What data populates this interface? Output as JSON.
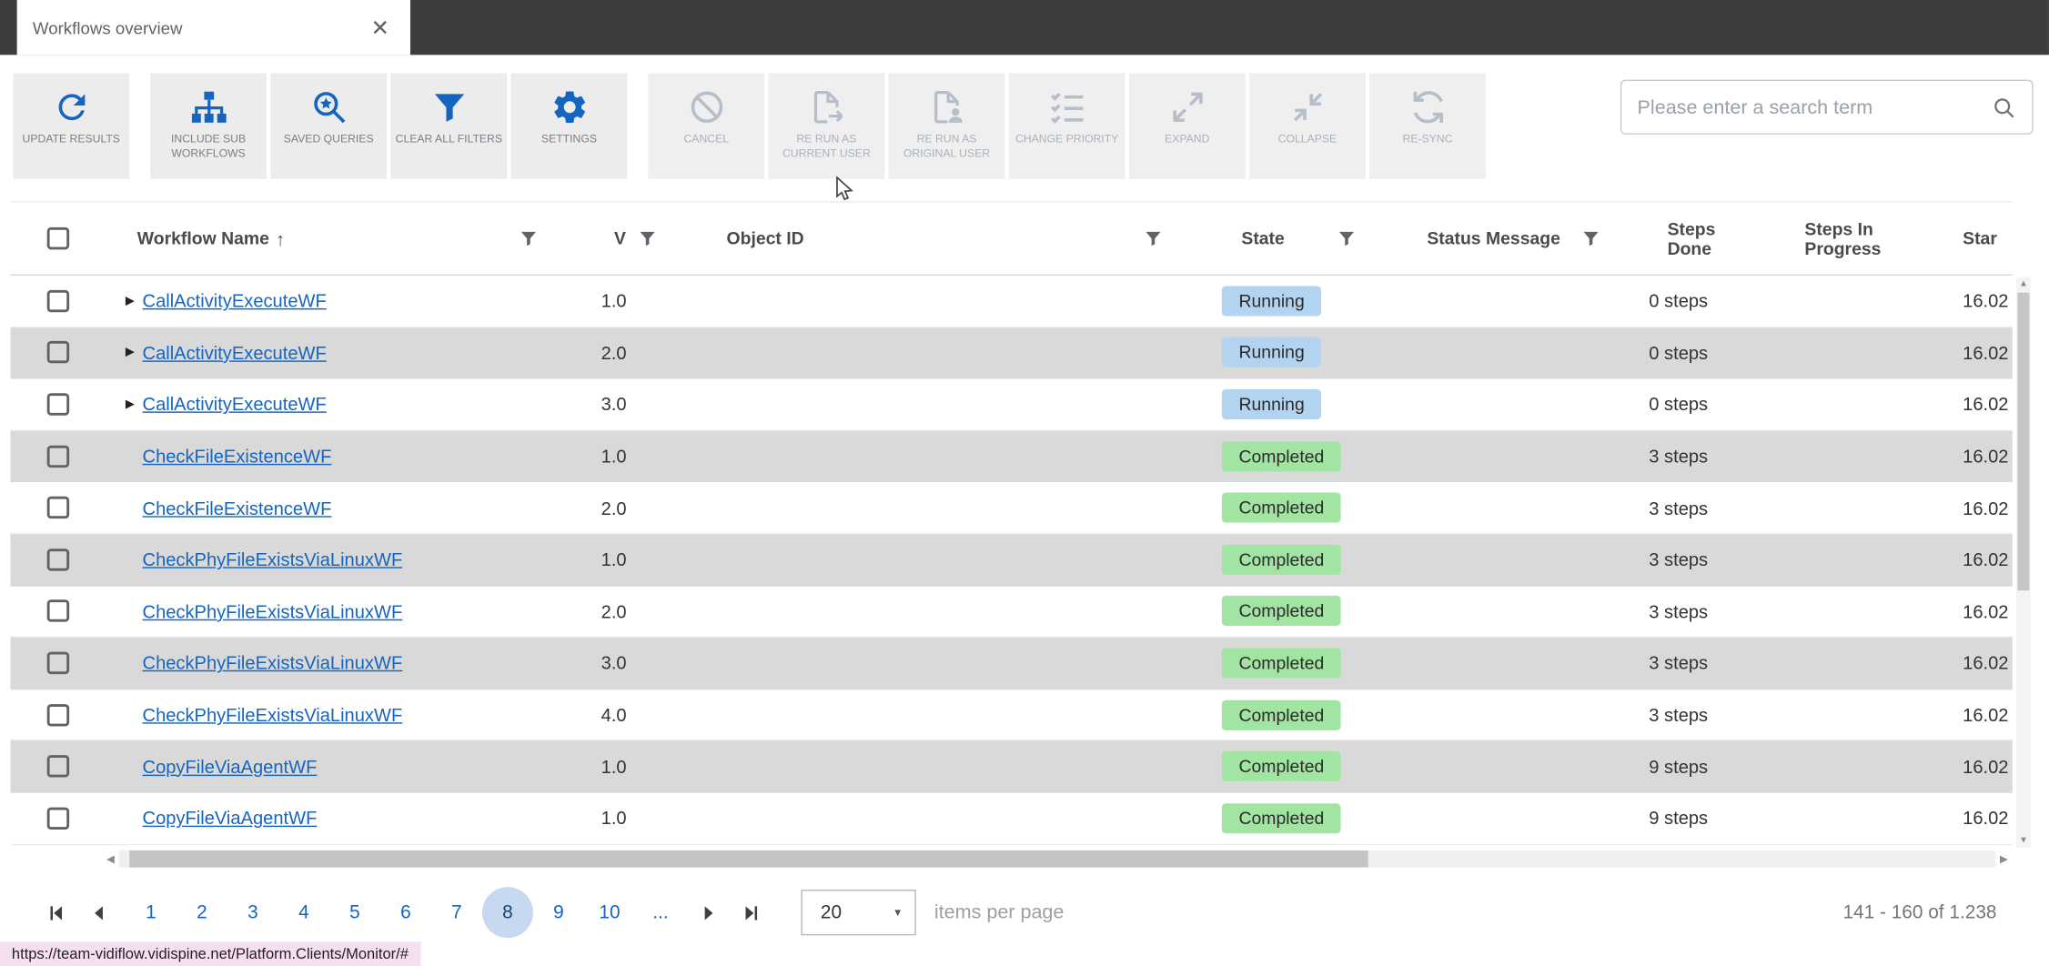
{
  "tab": {
    "title": "Workflows overview"
  },
  "toolbar": {
    "buttons": [
      {
        "label": "UPDATE RESULTS",
        "icon": "refresh-icon",
        "enabled": true
      },
      {
        "label": "INCLUDE SUB WORKFLOWS",
        "icon": "hierarchy-icon",
        "enabled": true
      },
      {
        "label": "SAVED QUERIES",
        "icon": "saved-search-icon",
        "enabled": true
      },
      {
        "label": "CLEAR ALL FILTERS",
        "icon": "clear-filters-icon",
        "enabled": true
      },
      {
        "label": "SETTINGS",
        "icon": "gear-icon",
        "enabled": true
      },
      {
        "label": "CANCEL",
        "icon": "cancel-icon",
        "enabled": false
      },
      {
        "label": "RE RUN AS CURRENT USER",
        "icon": "rerun-current-user-icon",
        "enabled": false
      },
      {
        "label": "RE RUN AS ORIGINAL USER",
        "icon": "rerun-original-user-icon",
        "enabled": false
      },
      {
        "label": "CHANGE PRIORITY",
        "icon": "priority-list-icon",
        "enabled": false
      },
      {
        "label": "EXPAND",
        "icon": "expand-icon",
        "enabled": false
      },
      {
        "label": "COLLAPSE",
        "icon": "collapse-icon",
        "enabled": false
      },
      {
        "label": "RE-SYNC",
        "icon": "resync-icon",
        "enabled": false
      }
    ],
    "search": {
      "placeholder": "Please enter a search term"
    }
  },
  "table": {
    "columns": [
      {
        "label": "",
        "key": "select"
      },
      {
        "label": "Workflow Name",
        "key": "name",
        "sorted": "asc",
        "filter": true
      },
      {
        "label": "V",
        "key": "version",
        "filter": true
      },
      {
        "label": "Object ID",
        "key": "object_id",
        "filter": true
      },
      {
        "label": "State",
        "key": "state",
        "filter": true
      },
      {
        "label": "Status Message",
        "key": "status_message",
        "filter": true
      },
      {
        "label": "Steps Done",
        "key": "steps_done",
        "filter": false
      },
      {
        "label": "Steps In Progress",
        "key": "steps_in_progress",
        "filter": false
      },
      {
        "label": "Star",
        "key": "started",
        "filter": false
      }
    ],
    "state_colors": {
      "Running": "#b3d4f0",
      "Completed": "#a2e5a2"
    },
    "rows": [
      {
        "name": "CallActivityExecuteWF",
        "expandable": true,
        "version": "1.0",
        "object_id": "",
        "state": "Running",
        "status_message": "",
        "steps_done": "0 steps",
        "steps_in_progress": "",
        "started": "16.02"
      },
      {
        "name": "CallActivityExecuteWF",
        "expandable": true,
        "version": "2.0",
        "object_id": "",
        "state": "Running",
        "status_message": "",
        "steps_done": "0 steps",
        "steps_in_progress": "",
        "started": "16.02"
      },
      {
        "name": "CallActivityExecuteWF",
        "expandable": true,
        "version": "3.0",
        "object_id": "",
        "state": "Running",
        "status_message": "",
        "steps_done": "0 steps",
        "steps_in_progress": "",
        "started": "16.02"
      },
      {
        "name": "CheckFileExistenceWF",
        "expandable": false,
        "version": "1.0",
        "object_id": "",
        "state": "Completed",
        "status_message": "",
        "steps_done": "3 steps",
        "steps_in_progress": "",
        "started": "16.02"
      },
      {
        "name": "CheckFileExistenceWF",
        "expandable": false,
        "version": "2.0",
        "object_id": "",
        "state": "Completed",
        "status_message": "",
        "steps_done": "3 steps",
        "steps_in_progress": "",
        "started": "16.02"
      },
      {
        "name": "CheckPhyFileExistsViaLinuxWF",
        "expandable": false,
        "version": "1.0",
        "object_id": "",
        "state": "Completed",
        "status_message": "",
        "steps_done": "3 steps",
        "steps_in_progress": "",
        "started": "16.02"
      },
      {
        "name": "CheckPhyFileExistsViaLinuxWF",
        "expandable": false,
        "version": "2.0",
        "object_id": "",
        "state": "Completed",
        "status_message": "",
        "steps_done": "3 steps",
        "steps_in_progress": "",
        "started": "16.02"
      },
      {
        "name": "CheckPhyFileExistsViaLinuxWF",
        "expandable": false,
        "version": "3.0",
        "object_id": "",
        "state": "Completed",
        "status_message": "",
        "steps_done": "3 steps",
        "steps_in_progress": "",
        "started": "16.02"
      },
      {
        "name": "CheckPhyFileExistsViaLinuxWF",
        "expandable": false,
        "version": "4.0",
        "object_id": "",
        "state": "Completed",
        "status_message": "",
        "steps_done": "3 steps",
        "steps_in_progress": "",
        "started": "16.02"
      },
      {
        "name": "CopyFileViaAgentWF",
        "expandable": false,
        "version": "1.0",
        "object_id": "",
        "state": "Completed",
        "status_message": "",
        "steps_done": "9 steps",
        "steps_in_progress": "",
        "started": "16.02"
      },
      {
        "name": "CopyFileViaAgentWF",
        "expandable": false,
        "version": "1.0",
        "object_id": "",
        "state": "Completed",
        "status_message": "",
        "steps_done": "9 steps",
        "steps_in_progress": "",
        "started": "16.02"
      }
    ]
  },
  "pagination": {
    "pages": [
      "1",
      "2",
      "3",
      "4",
      "5",
      "6",
      "7",
      "8",
      "9",
      "10",
      "..."
    ],
    "selected": "8",
    "per_page": "20",
    "items_per_page_label": "items per page",
    "range_label": "141 - 160 of 1.238"
  },
  "status_bar": {
    "url": "https://team-vidiflow.vidispine.net/Platform.Clients/Monitor/#"
  },
  "colors": {
    "accent_blue": "#1565c0",
    "row_stripe": "#d9d9d9",
    "selected_page_bg": "#c6d9f1"
  }
}
